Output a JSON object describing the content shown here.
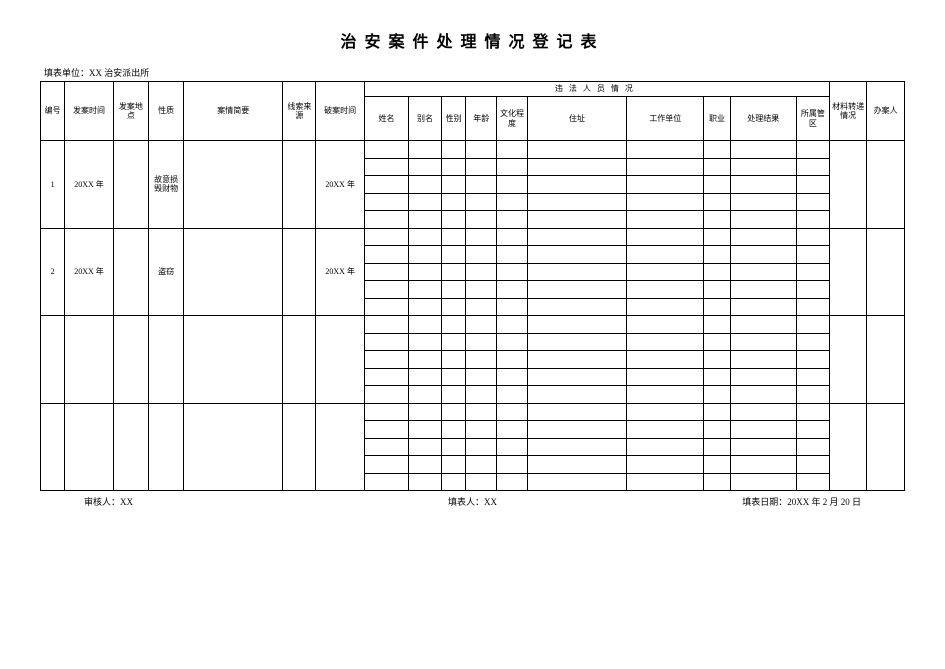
{
  "title": "治安案件处理情况登记表",
  "header_unit_label": "填表单位：",
  "header_unit_value": "XX 治安派出所",
  "group_header": "违法人员情况",
  "columns": {
    "c0": "编号",
    "c1": "发案时间",
    "c2": "发案地点",
    "c3": "性质",
    "c4": "案情简要",
    "c5": "线索来源",
    "c6": "破案时间",
    "c7": "姓名",
    "c8": "别名",
    "c9": "性别",
    "c10": "年龄",
    "c11": "文化程度",
    "c12": "住址",
    "c13": "工作单位",
    "c14": "职业",
    "c15": "处理结果",
    "c16": "所属管区",
    "c17": "材料转递情况",
    "c18": "办案人"
  },
  "rows": [
    {
      "no": "1",
      "time": "20XX 年",
      "place": "",
      "nature": "故意损毁财物",
      "summary": "",
      "source": "",
      "solve_time": "20XX 年"
    },
    {
      "no": "2",
      "time": "20XX 年",
      "place": "",
      "nature": "盗窃",
      "summary": "",
      "source": "",
      "solve_time": "20XX 年"
    },
    {
      "no": "",
      "time": "",
      "place": "",
      "nature": "",
      "summary": "",
      "source": "",
      "solve_time": ""
    },
    {
      "no": "",
      "time": "",
      "place": "",
      "nature": "",
      "summary": "",
      "source": "",
      "solve_time": ""
    }
  ],
  "footer": {
    "approver_label": "审核人：",
    "approver_value": "XX",
    "preparer_label": "填表人：",
    "preparer_value": "XX",
    "date_label": "填表日期：",
    "date_value": "20XX 年 2 月 20 日"
  }
}
